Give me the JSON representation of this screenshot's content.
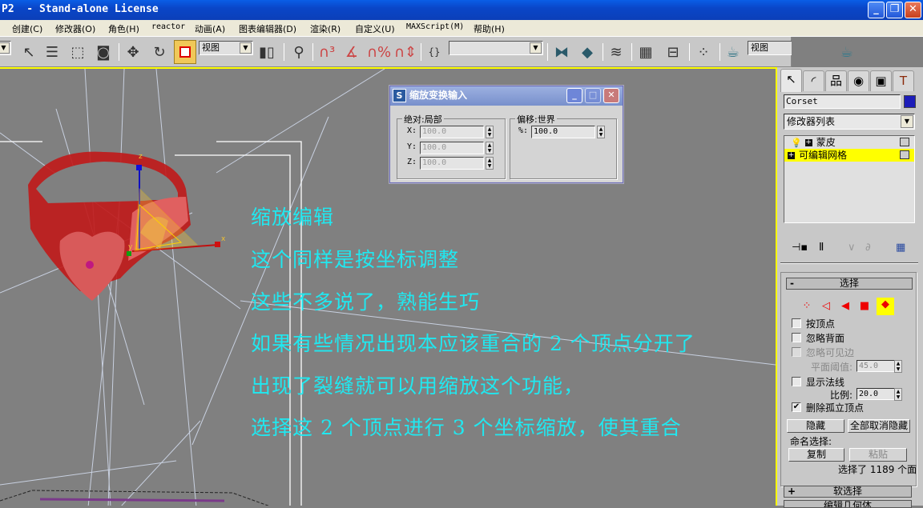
{
  "window": {
    "title": "P2  - Stand-alone License",
    "minimize": "_",
    "restore": "❐",
    "close": "✕"
  },
  "menu": [
    {
      "label": "创建(C)"
    },
    {
      "label": "修改器(O)"
    },
    {
      "label": "角色(H)"
    },
    {
      "label": "reactor"
    },
    {
      "label": "动画(A)"
    },
    {
      "label": "图表编辑器(D)"
    },
    {
      "label": "渲染(R)"
    },
    {
      "label": "自定义(U)"
    },
    {
      "label": "MAXScript(M)"
    },
    {
      "label": "帮助(H)"
    }
  ],
  "toolbar": {
    "ref_coord_value": "视图",
    "named_selection_value": "",
    "render_view_value": "视图",
    "icons": [
      "select-icon",
      "select-by-name-icon",
      "rect-region-icon",
      "window-crossing-icon",
      "move-icon",
      "rotate-icon",
      "scale-icon",
      "pivot-icon",
      "manipulate-icon",
      "snap-3d-icon",
      "angle-snap-icon",
      "percent-snap-icon",
      "spinner-snap-icon",
      "edit-named-sel-icon",
      "mirror-icon",
      "align-icon",
      "layer-icon",
      "curve-editor-icon",
      "schematic-icon",
      "material-editor-icon",
      "render-scene-icon",
      "quick-render-icon"
    ]
  },
  "dialog": {
    "title": "缩放变换输入",
    "absolute_group": "绝对:局部",
    "offset_group": "偏移:世界",
    "x_label": "X:",
    "y_label": "Y:",
    "z_label": "Z:",
    "x_value": "100.0",
    "y_value": "100.0",
    "z_value": "100.0",
    "percent_label": "%:",
    "percent_value": "100.0"
  },
  "viewport": {
    "gizmo": {
      "x_label": "x",
      "y_label": "y",
      "z_label": "z"
    },
    "captions": [
      "缩放编辑",
      "这个同样是按坐标调整",
      "这些不多说了，熟能生巧",
      "如果有些情况出现本应该重合的 2 个顶点分开了",
      "出现了裂缝就可以用缩放这个功能，",
      "选择这 2 个顶点进行 3 个坐标缩放，使其重合"
    ],
    "caption_color": "#20e8f0",
    "selection_color": "#ffff00"
  },
  "command_panel": {
    "tabs": [
      "create-tab",
      "modify-tab",
      "hierarchy-tab",
      "motion-tab",
      "display-tab",
      "utilities-tab"
    ],
    "object_name": "Corset",
    "object_color": "#1c1cb8",
    "modifier_list": "修改器列表",
    "stack": [
      {
        "label": "蒙皮",
        "highlighted": false
      },
      {
        "label": "可编辑网格",
        "highlighted": true
      }
    ],
    "selection_rollout": {
      "title": "选择",
      "collapse_sign": "-",
      "by_vertex": "按顶点",
      "ignore_backfacing": "忽略背面",
      "ignore_visible_edges": "忽略可见边",
      "planar_thresh_label": "平面阈值:",
      "planar_thresh_value": "45.0",
      "show_normals": "显示法线",
      "scale_label": "比例:",
      "scale_value": "20.0",
      "delete_isolated": "删除孤立顶点",
      "delete_isolated_checked": true,
      "hide_button": "隐藏",
      "unhide_all_button": "全部取消隐藏",
      "named_sel_label": "命名选择:",
      "copy_button": "复制",
      "paste_button": "粘贴",
      "status": "选择了 1189 个面"
    },
    "soft_selection_rollout": {
      "title": "软选择",
      "expand_sign": "+"
    },
    "edit_geometry_rollout": {
      "title": "编辑几何体"
    }
  }
}
